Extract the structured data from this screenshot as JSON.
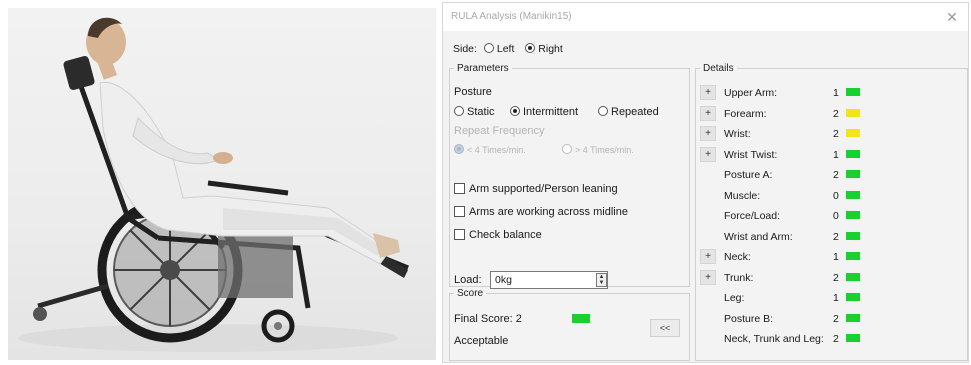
{
  "dialog": {
    "title": "RULA Analysis (Manikin15)",
    "close_glyph": "✕"
  },
  "side": {
    "label": "Side:",
    "options": [
      "Left",
      "Right"
    ],
    "selected": "Right"
  },
  "parameters": {
    "legend": "Parameters",
    "posture_label": "Posture",
    "posture_options": [
      "Static",
      "Intermittent",
      "Repeated"
    ],
    "posture_selected": "Intermittent",
    "repeat_frequency_label": "Repeat Frequency",
    "repeat_options": [
      "< 4 Times/min.",
      "> 4 Times/min."
    ],
    "repeat_selected": "< 4 Times/min.",
    "checkboxes": [
      "Arm supported/Person leaning",
      "Arms are working across midline",
      "Check balance"
    ],
    "load_label": "Load:",
    "load_value": "0kg"
  },
  "score": {
    "legend": "Score",
    "final_score": "Final Score: 2",
    "verdict": "Acceptable",
    "color": "#18d12e",
    "expand_label": "<<"
  },
  "details": {
    "legend": "Details",
    "rows": [
      {
        "toggle": "+",
        "label": "Upper Arm:",
        "value": "1",
        "color": "#18d12e"
      },
      {
        "toggle": "+",
        "label": "Forearm:",
        "value": "2",
        "color": "#f2e51b"
      },
      {
        "toggle": "+",
        "label": "Wrist:",
        "value": "2",
        "color": "#f2e51b"
      },
      {
        "toggle": "+",
        "label": "Wrist Twist:",
        "value": "1",
        "color": "#18d12e"
      },
      {
        "toggle": "",
        "label": "Posture A:",
        "value": "2",
        "color": "#18d12e"
      },
      {
        "toggle": "",
        "label": "Muscle:",
        "value": "0",
        "color": "#18d12e"
      },
      {
        "toggle": "",
        "label": "Force/Load:",
        "value": "0",
        "color": "#18d12e"
      },
      {
        "toggle": "",
        "label": "Wrist and Arm:",
        "value": "2",
        "color": "#18d12e"
      },
      {
        "toggle": "+",
        "label": "Neck:",
        "value": "1",
        "color": "#18d12e"
      },
      {
        "toggle": "+",
        "label": "Trunk:",
        "value": "2",
        "color": "#18d12e"
      },
      {
        "toggle": "",
        "label": "Leg:",
        "value": "1",
        "color": "#18d12e"
      },
      {
        "toggle": "",
        "label": "Posture B:",
        "value": "2",
        "color": "#18d12e"
      },
      {
        "toggle": "",
        "label": "Neck, Trunk and Leg:",
        "value": "2",
        "color": "#18d12e"
      }
    ]
  }
}
